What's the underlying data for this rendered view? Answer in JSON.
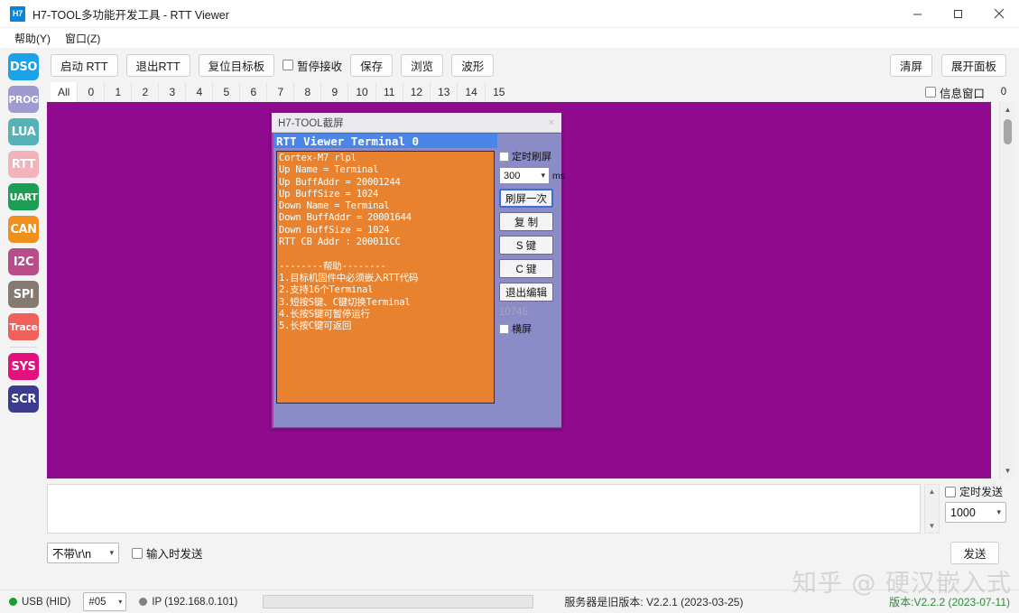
{
  "window": {
    "icon_label": "H7",
    "title": "H7-TOOL多功能开发工具 - RTT Viewer",
    "minimize": "minimize-icon",
    "maximize": "maximize-icon",
    "close": "close-icon"
  },
  "menubar": {
    "items": [
      {
        "label": "帮助(Y)"
      },
      {
        "label": "窗口(Z)"
      }
    ]
  },
  "rail": {
    "items": [
      {
        "label": "DSO",
        "color": "#1aa3e8"
      },
      {
        "label": "PROG",
        "color": "#9e9bd0"
      },
      {
        "label": "LUA",
        "color": "#55b3b8"
      },
      {
        "label": "RTT",
        "color": "#f2b3bc"
      },
      {
        "label": "UART",
        "color": "#1b9e54"
      },
      {
        "label": "CAN",
        "color": "#ef8f1c"
      },
      {
        "label": "I2C",
        "color": "#b74e8a"
      },
      {
        "label": "SPI",
        "color": "#857a72"
      },
      {
        "label": "Trace",
        "color": "#f2605b"
      },
      {
        "label": "SYS",
        "color": "#e2117e"
      },
      {
        "label": "SCR",
        "color": "#3b3b8f"
      }
    ]
  },
  "toolbar": {
    "start_rtt": "启动 RTT",
    "exit_rtt": "退出RTT",
    "reset_target": "复位目标板",
    "pause_recv": "暂停接收",
    "save": "保存",
    "browse": "浏览",
    "wave": "波形",
    "clear_screen": "清屏",
    "expand_panel": "展开面板"
  },
  "tabs": {
    "items": [
      "All",
      "0",
      "1",
      "2",
      "3",
      "4",
      "5",
      "6",
      "7",
      "8",
      "9",
      "10",
      "11",
      "12",
      "13",
      "14",
      "15"
    ],
    "active": "All",
    "info_window": "信息窗口",
    "scroll_value": "0"
  },
  "screenshot_window": {
    "title": "H7-TOOL截屏",
    "close": "×",
    "header": "RTT Viewer   Terminal 0",
    "terminal_text": "Cortex-M7 rlpl\nUp Name = Terminal\nUp BuffAddr = 20001244\nUp BuffSize = 1024\nDown Name = Terminal\nDown BuffAddr = 20001644\nDown BuffSize = 1024\nRTT CB Addr : 200011CC\n\n--------帮助--------\n1.目标机固件中必须嵌入RTT代码\n2.支持16个Terminal\n3.短按S键、C键切换Terminal\n4.长按S键可暂停运行\n5.长按C键可返回",
    "side_panel": {
      "timed_refresh": "定时刷屏",
      "interval_value": "300",
      "interval_unit": "ms",
      "refresh_once": "刷屏一次",
      "copy": "复 制",
      "s_key": "S 键",
      "c_key": "C 键",
      "exit_edit": "退出编辑",
      "counter": "10745",
      "landscape": "横屏"
    }
  },
  "send_area": {
    "line_ending": "不带\\r\\n",
    "send_on_input": "输入时发送",
    "timed_send": "定时发送",
    "interval_value": "1000",
    "send_button": "发送"
  },
  "statusbar": {
    "usb_label": "USB (HID)",
    "usb_color": "#1a9d2f",
    "device_id": "#05",
    "ip_label": "IP (192.168.0.101)",
    "ip_color": "#808080",
    "server_version": "服务器是旧版本: V2.2.1 (2023-03-25)",
    "app_version": "版本:V2.2.2 (2023-07-11)",
    "version_color": "#2e8b3d"
  },
  "watermark": {
    "text": "知乎 @ 硬汉嵌入式"
  }
}
